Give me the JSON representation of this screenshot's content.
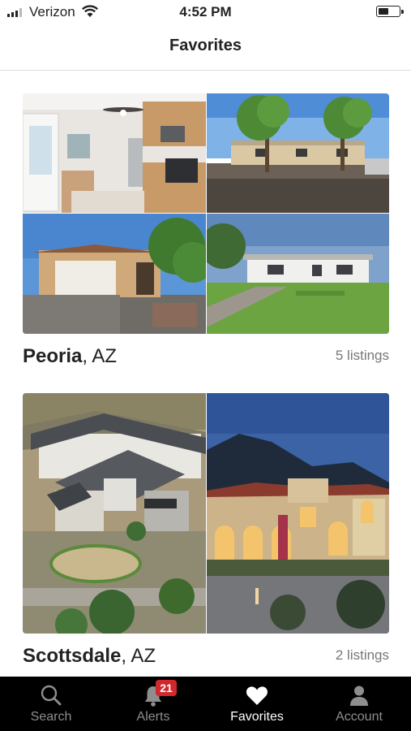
{
  "status_bar": {
    "carrier": "Verizon",
    "time": "4:52 PM"
  },
  "header": {
    "title": "Favorites"
  },
  "favorites": [
    {
      "city": "Peoria",
      "state": ", AZ",
      "listings": "5 listings"
    },
    {
      "city": "Scottsdale",
      "state": ", AZ",
      "listings": "2 listings"
    }
  ],
  "tabs": [
    {
      "label": "Search",
      "icon": "search-icon"
    },
    {
      "label": "Alerts",
      "icon": "bell-icon",
      "badge": "21"
    },
    {
      "label": "Favorites",
      "icon": "heart-icon",
      "active": true
    },
    {
      "label": "Account",
      "icon": "person-icon"
    }
  ],
  "colors": {
    "badge": "#d0282d",
    "tabbar": "#000000",
    "active_tab": "#ffffff",
    "inactive_tab": "#8e8e8e"
  }
}
